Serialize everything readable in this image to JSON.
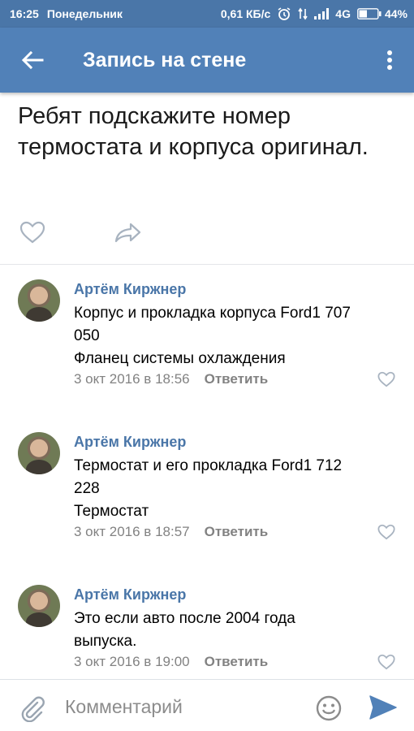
{
  "status_bar": {
    "time": "16:25",
    "day": "Понедельник",
    "speed": "0,61 КБ/с",
    "network": "4G",
    "battery": "44%",
    "battery_level": 0.44
  },
  "toolbar": {
    "title": "Запись на стене"
  },
  "post": {
    "text": "Ребят подскажите номер термостата и корпуса оригинал."
  },
  "comments": [
    {
      "author": "Артём Киржнер",
      "text_lines": [
        "Корпус и прокладка корпуса Ford1 707",
        "050",
        "Фланец системы охлаждения"
      ],
      "date": "3 окт 2016 в 18:56",
      "reply": "Ответить"
    },
    {
      "author": "Артём Киржнер",
      "text_lines": [
        "Термостат и его прокладка Ford1 712",
        "228",
        "Термостат"
      ],
      "date": "3 окт 2016 в 18:57",
      "reply": "Ответить"
    },
    {
      "author": "Артём Киржнер",
      "text_lines": [
        "Это если авто после 2004 года",
        "выпуска."
      ],
      "date": "3 окт 2016 в 19:00",
      "reply": "Ответить"
    }
  ],
  "input": {
    "placeholder": "Комментарий",
    "value": ""
  },
  "icons": {
    "back": "arrow-left-icon",
    "more": "more-vertical-icon",
    "like": "heart-icon",
    "share": "share-arrow-icon",
    "attach": "paperclip-icon",
    "emoji": "smiley-icon",
    "send": "send-icon"
  },
  "colors": {
    "header": "#5181b8",
    "status_bar": "#4a76a8",
    "author": "#4a76a8",
    "meta": "#828282",
    "send": "#5181b8"
  }
}
